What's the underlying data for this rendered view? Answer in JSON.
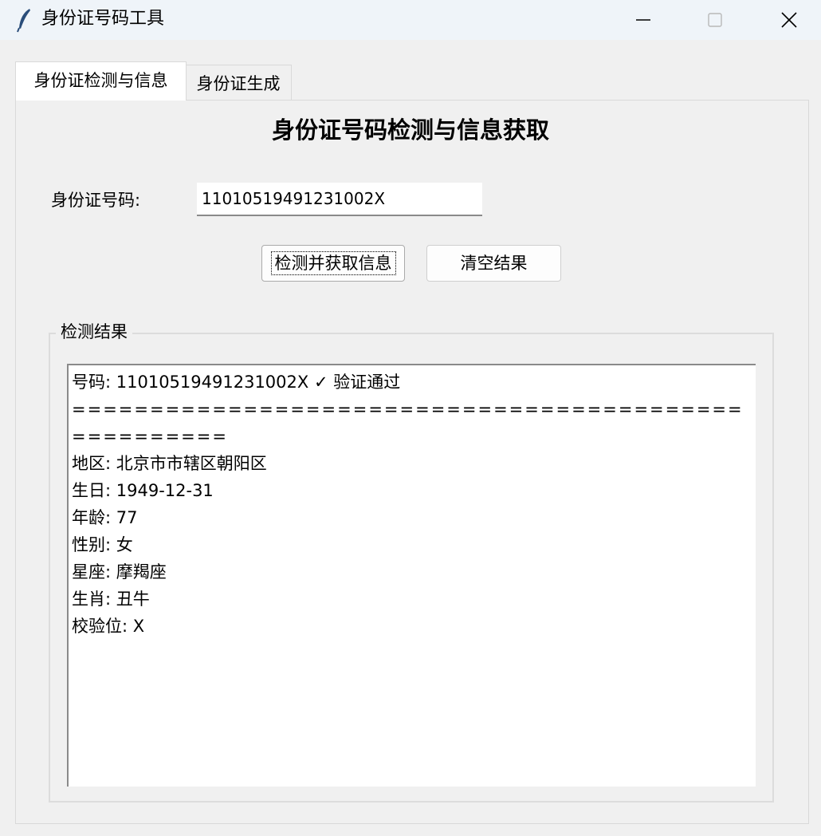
{
  "window": {
    "title": "身份证号码工具"
  },
  "tabs": [
    {
      "label": "身份证检测与信息"
    },
    {
      "label": "身份证生成"
    }
  ],
  "main": {
    "heading": "身份证号码检测与信息获取",
    "id_label": "身份证号码:",
    "id_value": "11010519491231002X",
    "detect_button": "检测并获取信息",
    "clear_button": "清空结果",
    "result_group_label": "检测结果"
  },
  "result": {
    "line1": "号码: 11010519491231002X ✓ 验证通过",
    "separator": "=====================================================",
    "region": "地区: 北京市市辖区朝阳区",
    "birthday": "生日: 1949-12-31",
    "age": "年龄: 77",
    "gender": "性别: 女",
    "constellation": "星座: 摩羯座",
    "zodiac": "生肖: 丑牛",
    "check_digit": "校验位: X"
  },
  "icons": {
    "app": "feather-icon",
    "minimize": "minimize-icon",
    "maximize": "maximize-icon",
    "close": "close-icon"
  }
}
